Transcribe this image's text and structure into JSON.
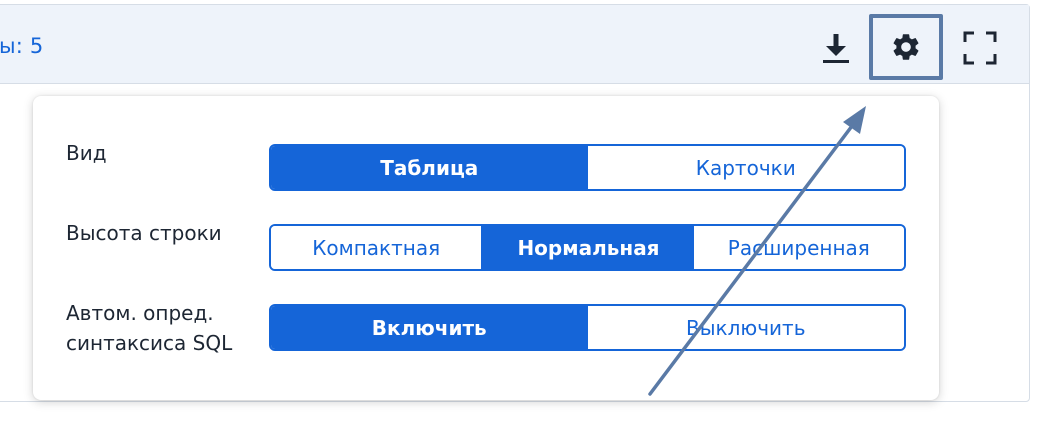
{
  "header": {
    "rows_count_text": "ы: 5"
  },
  "toolbar": {
    "download_icon": "download-icon",
    "settings_icon": "gear-icon",
    "fullscreen_icon": "fullscreen-icon"
  },
  "settings": {
    "view": {
      "label": "Вид",
      "options": [
        "Таблица",
        "Карточки"
      ],
      "selected": "Таблица"
    },
    "row_height": {
      "label": "Высота строки",
      "options": [
        "Компактная",
        "Нормальная",
        "Расширенная"
      ],
      "selected": "Нормальная"
    },
    "sql_syntax": {
      "label_line1": "Автом. опред.",
      "label_line2": "синтаксиса SQL",
      "options": [
        "Включить",
        "Выключить"
      ],
      "selected": "Включить"
    }
  },
  "colors": {
    "accent": "#1565d8",
    "header_bg": "#eef3fa",
    "annotation": "#5a7aa6"
  }
}
